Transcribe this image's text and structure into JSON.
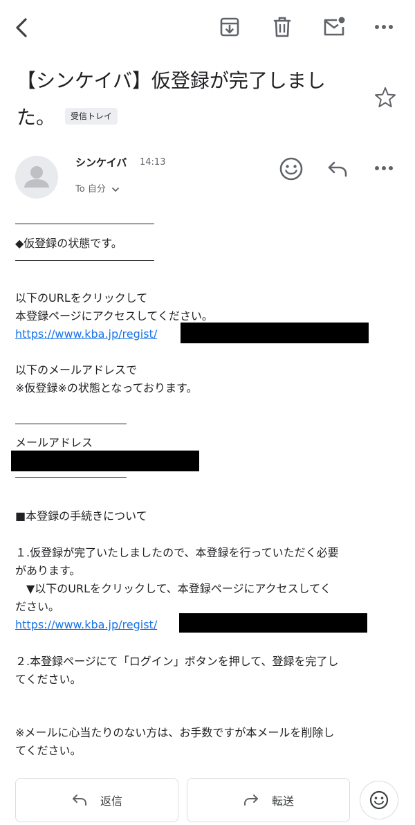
{
  "toolbar": {
    "back_icon": "chevron-left-icon",
    "archive_icon": "archive-icon",
    "delete_icon": "trash-icon",
    "unread_icon": "mark-unread-icon",
    "more_icon": "more-horizontal-icon"
  },
  "subject": {
    "line1": "【シンケイバ】仮登録が完了しまし",
    "line2": "た。",
    "label": "受信トレイ"
  },
  "sender": {
    "name": "シンケイバ",
    "time": "14:13",
    "recipient": "To 自分"
  },
  "body": {
    "section_title": "◆仮登録の状態です。",
    "instruction_1": "以下のURLをクリックして",
    "instruction_2": "本登録ページにアクセスしてください。",
    "link_1": "https://www.kba.jp/regist/",
    "email_note_1": "以下のメールアドレスで",
    "email_note_2": "※仮登録※の状態となっております。",
    "email_heading": "メールアドレス",
    "procedure_title": "■本登録の手続きについて",
    "step1_line1": "１.仮登録が完了いたしましたので、本登録を行っていただく必要",
    "step1_line2": "があります。",
    "step1_line3": "　▼以下のURLをクリックして、本登録ページにアクセスしてく",
    "step1_line4": "ださい。",
    "link_2": "https://www.kba.jp/regist/",
    "step2_line1": "２.本登録ページにて「ログイン」ボタンを押して、登録を完了し",
    "step2_line2": "てください。",
    "note_line1": "※メールに心当たりのない方は、お手数ですが本メールを削除し",
    "note_line2": "てください。"
  },
  "actions": {
    "reply_label": "返信",
    "forward_label": "転送"
  },
  "colors": {
    "link": "#1a73e8",
    "text": "#202124",
    "icon": "#5f6368"
  }
}
